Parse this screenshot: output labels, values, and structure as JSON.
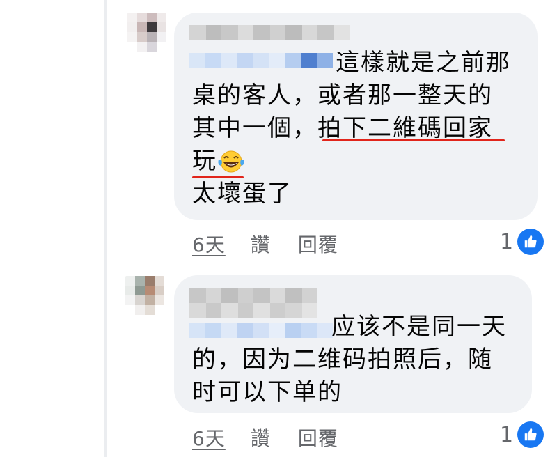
{
  "comments": [
    {
      "lines": [
        "這樣就是之前那",
        "桌的客人，或者那一整天的",
        "其中一個，拍下二維碼回家",
        "玩",
        "太壞蛋了"
      ],
      "emoji": "laughing-with-tears",
      "time": "6天",
      "like_label": "讚",
      "reply_label": "回覆",
      "reaction_count": "1"
    },
    {
      "lines": [
        "应该不是同一天",
        "的，因为二维码拍照后，随",
        "时可以下单的"
      ],
      "time": "6天",
      "like_label": "讚",
      "reply_label": "回覆",
      "reaction_count": "1"
    }
  ],
  "colors": {
    "bubble": "#f0f2f5",
    "underline": "#e1251b",
    "like_blue": "#1877f2",
    "secondary_text": "#65676b"
  }
}
